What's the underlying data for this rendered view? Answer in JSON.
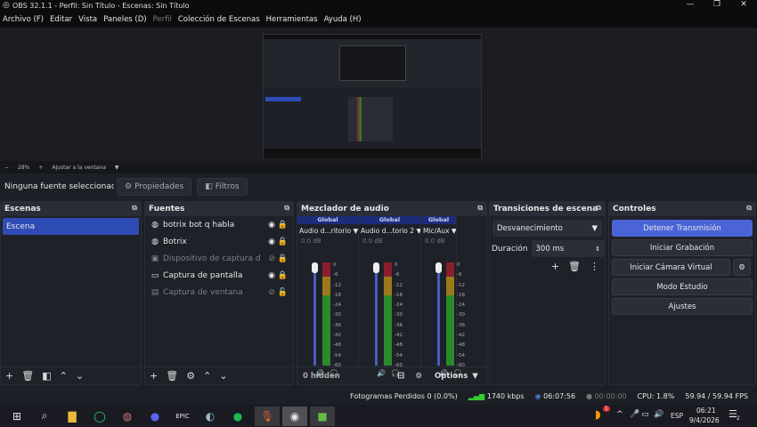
{
  "window": {
    "title": "OBS 32.1.1 - Perfil: Sin Título - Escenas: Sin Título"
  },
  "menu": [
    "Archivo (F)",
    "Editar",
    "Vista",
    "Paneles (D)",
    "Perfil",
    "Colección de Escenas",
    "Herramientas",
    "Ayuda (H)"
  ],
  "zoombar": {
    "minus": "−",
    "zoom": "28%",
    "plus": "+",
    "fit": "Ajustar a la ventana"
  },
  "source_bar": {
    "none_selected": "Ninguna fuente seleccionad",
    "properties": "Propiedades",
    "filters": "Filtros"
  },
  "scenes": {
    "title": "Escenas",
    "items": [
      "Escena"
    ]
  },
  "sources": {
    "title": "Fuentes",
    "items": [
      {
        "name": "botrix bot q habla",
        "icon": "globe-icon",
        "visible": true,
        "locked": true
      },
      {
        "name": "Botrix",
        "icon": "globe-icon",
        "visible": true,
        "locked": true
      },
      {
        "name": "Dispositivo de captura de vide",
        "icon": "camera-icon",
        "visible": false,
        "locked": true
      },
      {
        "name": "Captura de pantalla",
        "icon": "monitor-icon",
        "visible": true,
        "locked": true
      },
      {
        "name": "Captura de ventana",
        "icon": "window-icon",
        "visible": false,
        "locked": false
      }
    ]
  },
  "mixer": {
    "title": "Mezclador de audio",
    "channels": [
      {
        "scope": "Global",
        "name": "Audio d...ritorio",
        "db": "0.0 dB"
      },
      {
        "scope": "Global",
        "name": "Audio d...torio 2",
        "db": "0.0 dB"
      },
      {
        "scope": "Global",
        "name": "Mic/Aux",
        "db": "0.0 dB"
      }
    ],
    "ticks": [
      "0",
      "-6",
      "-12",
      "-18",
      "-24",
      "-30",
      "-36",
      "-42",
      "-48",
      "-54",
      "-60"
    ],
    "hidden": "0 hidden",
    "options": "Options"
  },
  "transitions": {
    "title": "Transiciones de escena",
    "selected": "Desvanecimiento",
    "duration_label": "Duración",
    "duration": "300 ms"
  },
  "controls": {
    "title": "Controles",
    "stop_stream": "Detener Transmisión",
    "start_record": "Iniciar Grabación",
    "virtual_cam": "Iniciar Cámara Virtual",
    "studio": "Modo Estudio",
    "settings": "Ajustes"
  },
  "status": {
    "dropped": "Fotogramas Perdidos 0 (0.0%)",
    "bitrate": "1740 kbps",
    "stream_time": "06:07:56",
    "record_time": "00:00:00",
    "cpu": "CPU: 1.8%",
    "fps": "59.94 / 59.94 FPS"
  },
  "taskbar": {
    "lang": "ESP",
    "time": "06:21",
    "date": "9/4/2026",
    "notifications": "2",
    "badge": "1"
  },
  "colors": {
    "accent": "#4a64d8",
    "scene_selected": "#2f4bb5"
  }
}
